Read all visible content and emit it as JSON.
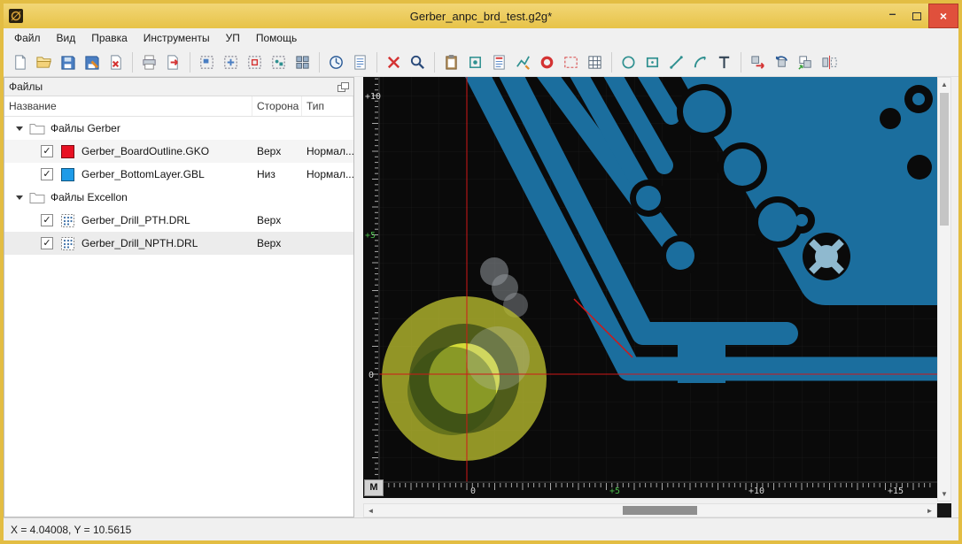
{
  "window": {
    "title": "Gerber_anpc_brd_test.g2g*",
    "controls": {
      "minimize": "–",
      "maximize": "",
      "close": "×"
    }
  },
  "menu": {
    "items": [
      "Файл",
      "Вид",
      "Правка",
      "Инструменты",
      "УП",
      "Помощь"
    ]
  },
  "toolbar": {
    "groups": [
      [
        "new-file",
        "open-file",
        "save-file",
        "save-as-file",
        "close-file"
      ],
      [
        "print-file",
        "export-file"
      ],
      [
        "zoom-window",
        "zoom-fit",
        "zoom-selection",
        "zoom-objects",
        "tile-view"
      ],
      [
        "simulation",
        "report"
      ],
      [
        "delete-selection",
        "search"
      ],
      [
        "paste-special",
        "aperture-editor",
        "layers-list",
        "edit-polyline",
        "pad-editor",
        "selection-frame",
        "aperture-table"
      ],
      [
        "draw-circle",
        "draw-rect",
        "draw-line",
        "draw-arc",
        "draw-text"
      ],
      [
        "move-object",
        "rotate-object",
        "copy-object",
        "mirror-object"
      ]
    ]
  },
  "files_panel": {
    "title": "Файлы",
    "columns": [
      "Название",
      "Сторона",
      "Тип"
    ],
    "check_glyph": "✓",
    "tree": [
      {
        "type": "folder",
        "label": "Файлы Gerber"
      },
      {
        "type": "layer",
        "checked": true,
        "swatch": "#e81123",
        "name": "Gerber_BoardOutline.GKO",
        "side": "Верх",
        "kind": "Нормал..."
      },
      {
        "type": "layer",
        "checked": true,
        "swatch": "#1e9be8",
        "name": "Gerber_BottomLayer.GBL",
        "side": "Низ",
        "kind": "Нормал..."
      },
      {
        "type": "folder",
        "label": "Файлы Excellon"
      },
      {
        "type": "drill",
        "checked": true,
        "name": "Gerber_Drill_PTH.DRL",
        "side": "Верх",
        "kind": ""
      },
      {
        "type": "drill",
        "checked": true,
        "name": "Gerber_Drill_NPTH.DRL",
        "side": "Верх",
        "kind": ""
      }
    ]
  },
  "canvas": {
    "mode_button": "M",
    "ruler_v": [
      {
        "label": "+10"
      },
      {
        "label": "+5"
      },
      {
        "label": "0"
      }
    ],
    "ruler_h": [
      {
        "label": "0"
      },
      {
        "label": "+5"
      },
      {
        "label": "+10"
      },
      {
        "label": "+15"
      }
    ],
    "colors": {
      "background": "#0a0a0a",
      "grid": "#171717",
      "copper": "#1b6e9e",
      "outline": "#d01818",
      "highlight_outer": "#b9bd2e",
      "highlight_inner": "#d3da38"
    }
  },
  "status_bar": {
    "coordinates": "X = 4.04008, Y = 10.5615"
  }
}
